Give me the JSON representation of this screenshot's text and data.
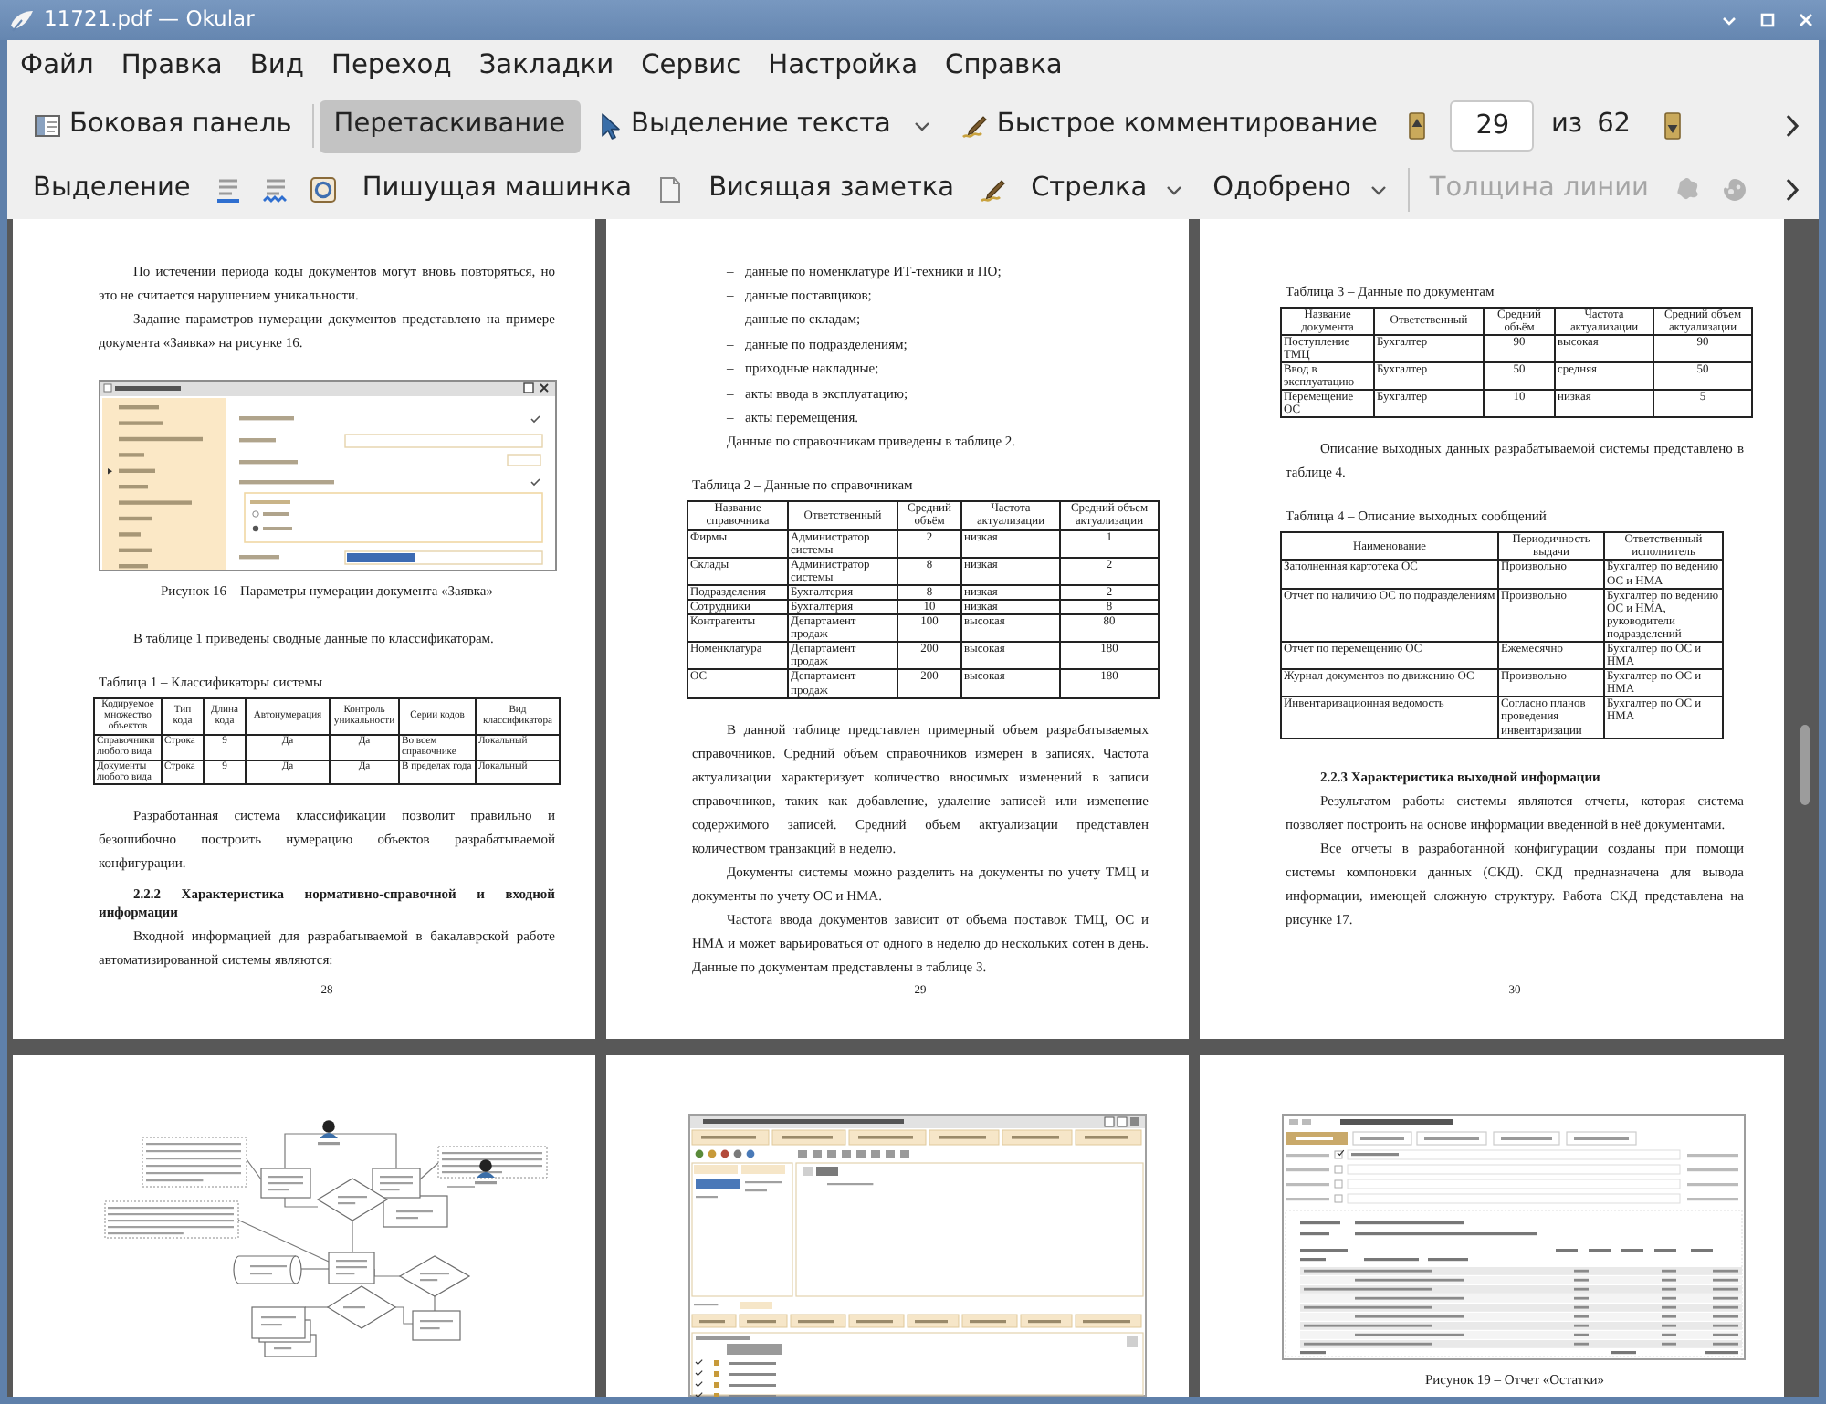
{
  "window": {
    "title": "11721.pdf — Okular"
  },
  "menu": [
    "Файл",
    "Правка",
    "Вид",
    "Переход",
    "Закладки",
    "Сервис",
    "Настройка",
    "Справка"
  ],
  "main_toolbar": {
    "sidebar": {
      "label": "Боковая панель"
    },
    "modes": [
      {
        "kind": "browse",
        "label": "Перетаскивание",
        "selected": true
      },
      {
        "kind": "select",
        "label": "Выделение текста",
        "selected": false
      }
    ],
    "annotations": {
      "label": "Быстрое комментирование"
    },
    "page_field": {
      "value": "29"
    },
    "page_of": "из",
    "page_total": "62"
  },
  "annotation_toolbar": [
    {
      "kind": "highlight",
      "label": "Выделение",
      "disabled": false
    },
    {
      "kind": "underline",
      "disabled": false
    },
    {
      "kind": "squiggle",
      "disabled": false
    },
    {
      "kind": "strikeout",
      "disabled": false
    },
    {
      "kind": "typewriter",
      "label": "Пишущая машинка",
      "disabled": false
    },
    {
      "kind": "note",
      "disabled": false
    },
    {
      "kind": "popup",
      "label": "Висящая заметка",
      "disabled": false
    },
    {
      "kind": "freehand",
      "disabled": false
    },
    {
      "kind": "shape",
      "label": "Стрелка",
      "disabled": false
    },
    {
      "kind": "stamp",
      "label": "Одобрено",
      "disabled": false
    },
    {
      "kind": "width",
      "label": "Толщина линии",
      "disabled": true
    },
    {
      "kind": "color",
      "disabled": true
    },
    {
      "kind": "opacity",
      "disabled": true
    }
  ],
  "pages": [
    {
      "number": "28",
      "blocks": [
        {
          "kind": "paragraph",
          "text": "По истечении периода коды документов могут вновь повторяться, но это не считается нарушением уникальности."
        },
        {
          "kind": "paragraph",
          "text": "Задание параметров нумерации документов представлено на примере документа «Заявка» на рисунке 16."
        },
        {
          "kind": "dialog"
        },
        {
          "kind": "figure_caption",
          "text": "Рисунок 16 – Параметры нумерации документа «Заявка»"
        },
        {
          "kind": "paragraph",
          "text": "В таблице 1 приведены сводные данные по классификаторам."
        },
        {
          "kind": "table_caption",
          "text": "Таблица 1 – Классификаторы системы"
        },
        {
          "kind": "table",
          "columns": [
            "Кодируемое множество объектов",
            "Тип кода",
            "Длина кода",
            "Автонумерация",
            "Контроль уникальности",
            "Серии кодов",
            "Вид классификатора"
          ],
          "rows": [
            [
              "Справочники любого вида",
              "Строка",
              "9",
              "Да",
              "Да",
              "Во всем справочнике",
              "Локальный"
            ],
            [
              "Документы любого вида",
              "Строка",
              "9",
              "Да",
              "Да",
              "В пределах года",
              "Локальный"
            ]
          ]
        },
        {
          "kind": "paragraph",
          "text": "Разработанная система классификации позволит правильно и безошибочно построить нумерацию объектов разрабатываемой конфигурации."
        },
        {
          "kind": "heading",
          "text": "2.2.2 Характеристика нормативно-справочной и входной информации"
        },
        {
          "kind": "paragraph",
          "text": "Входной информацией для разрабатываемой в бакалаврской работе автоматизированной системы являются:"
        }
      ]
    },
    {
      "number": "29",
      "blocks": [
        {
          "kind": "bullet",
          "marker": "–",
          "text": "данные по номенклатуре ИТ-техники и ПО;"
        },
        {
          "kind": "bullet",
          "marker": "–",
          "text": "данные поставщиков;"
        },
        {
          "kind": "bullet",
          "marker": "–",
          "text": "данные по складам;"
        },
        {
          "kind": "bullet",
          "marker": "–",
          "text": "данные по подразделениям;"
        },
        {
          "kind": "bullet",
          "marker": "–",
          "text": "приходные накладные;"
        },
        {
          "kind": "bullet",
          "marker": "–",
          "text": "акты ввода в эксплуатацию;"
        },
        {
          "kind": "bullet",
          "marker": "–",
          "text": "акты перемещения."
        },
        {
          "kind": "paragraph",
          "text": "Данные по справочникам приведены в таблице 2."
        },
        {
          "kind": "table_caption",
          "text": "Таблица 2 – Данные по справочникам"
        },
        {
          "kind": "table",
          "columns": [
            "Название справочника",
            "Ответственный",
            "Средний объём",
            "Частота актуализации",
            "Средний объем актуализации"
          ],
          "rows": [
            [
              "Фирмы",
              "Администратор системы",
              "2",
              "низкая",
              "1"
            ],
            [
              "Склады",
              "Администратор системы",
              "8",
              "низкая",
              "2"
            ],
            [
              "Подразделения",
              "Бухгалтерия",
              "8",
              "низкая",
              "2"
            ],
            [
              "Сотрудники",
              "Бухгалтерия",
              "10",
              "низкая",
              "8"
            ],
            [
              "Контрагенты",
              "Департамент продаж",
              "100",
              "высокая",
              "80"
            ],
            [
              "Номенклатура",
              "Департамент продаж",
              "200",
              "высокая",
              "180"
            ],
            [
              "ОС",
              "Департамент продаж",
              "200",
              "высокая",
              "180"
            ]
          ]
        },
        {
          "kind": "paragraph",
          "text": "В данной таблице представлен примерный объем разрабатываемых справочников. Средний объем справочников измерен в записях. Частота актуализации характеризует количество вносимых изменений в записи справочников, таких как добавление, удаление записей или изменение содержимого записей. Средний объем актуализации представлен количеством транзакций в неделю."
        },
        {
          "kind": "paragraph",
          "text": "Документы системы можно разделить на документы по учету ТМЦ и документы по учету ОС и НМА."
        },
        {
          "kind": "paragraph",
          "text": "Частота ввода документов зависит от объема поставок ТМЦ, ОС и НМА и может варьироваться от одного в неделю до нескольких сотен в день. Данные по документам представлены в таблице 3."
        }
      ]
    },
    {
      "number": "30",
      "blocks": [
        {
          "kind": "table_caption",
          "text": "Таблица 3 – Данные по документам"
        },
        {
          "kind": "table",
          "columns": [
            "Название документа",
            "Ответственный",
            "Средний объём",
            "Частота актуализации",
            "Средний объем актуализации"
          ],
          "rows": [
            [
              "Поступление ТМЦ",
              "Бухгалтер",
              "90",
              "высокая",
              "90"
            ],
            [
              "Ввод в эксплуатацию",
              "Бухгалтер",
              "50",
              "средняя",
              "50"
            ],
            [
              "Перемещение ОС",
              "Бухгалтер",
              "10",
              "низкая",
              "5"
            ]
          ]
        },
        {
          "kind": "paragraph",
          "text": "Описание выходных данных разрабатываемой системы представлено в таблице 4."
        },
        {
          "kind": "table_caption",
          "text": "Таблица 4 – Описание выходных сообщений"
        },
        {
          "kind": "table",
          "columns": [
            "Наименование",
            "Периодичность выдачи",
            "Ответственный исполнитель"
          ],
          "rows": [
            [
              "Заполненная картотека ОС",
              "Произвольно",
              "Бухгалтер по ведению ОС и НМА"
            ],
            [
              "Отчет по наличию ОС по подразделениям",
              "Произвольно",
              "Бухгалтер по ведению ОС и НМА, руководители подразделений"
            ],
            [
              "Отчет по перемещению ОС",
              "Ежемесячно",
              "Бухгалтер по ОС и НМА"
            ],
            [
              "Журнал документов по движению ОС",
              "Произвольно",
              "Бухгалтер по ОС и НМА"
            ],
            [
              "Инвентаризационная ведомость",
              "Согласно планов проведения инвентаризации",
              "Бухгалтер по ОС и НМА"
            ]
          ]
        },
        {
          "kind": "heading",
          "text": "2.2.3 Характеристика выходной информации"
        },
        {
          "kind": "paragraph",
          "text": "Результатом работы системы являются отчеты, которая система позволяет построить на основе информации введенной в неё документами."
        },
        {
          "kind": "paragraph",
          "text": "Все отчеты в разработанной конфигурации созданы при помощи системы компоновки данных (СКД). СКД предназначена для вывода информации, имеющей сложную структуру. Работа СКД представлена на рисунке 17."
        }
      ]
    },
    {
      "blocks": [
        {
          "kind": "flowchart"
        }
      ]
    },
    {
      "blocks": [
        {
          "kind": "appwindow"
        }
      ]
    },
    {
      "blocks": [
        {
          "kind": "report"
        },
        {
          "kind": "figure_caption",
          "text": "Рисунок 19 – Отчет «Остатки»"
        }
      ]
    }
  ]
}
